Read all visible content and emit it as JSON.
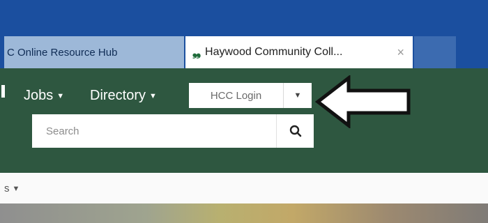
{
  "browser": {
    "tabs": [
      {
        "label": "C Online Resource Hub",
        "active": false
      },
      {
        "label": "Haywood Community Coll...",
        "active": true,
        "close": "×"
      }
    ]
  },
  "navbar": {
    "links": [
      {
        "label": "Jobs"
      },
      {
        "label": "Directory"
      }
    ],
    "login": {
      "label": "HCC Login"
    },
    "search": {
      "placeholder": "Search",
      "value": ""
    }
  },
  "subnav": {
    "label": "s"
  },
  "icons": {
    "favicon": "haywood-logo-icon",
    "search": "magnifier-icon",
    "pointer": "left-arrow-annotation"
  },
  "colors": {
    "tabstrip": "#1b4f9f",
    "navbar": "#2e5740",
    "tab_inactive": "#9db8d8"
  }
}
